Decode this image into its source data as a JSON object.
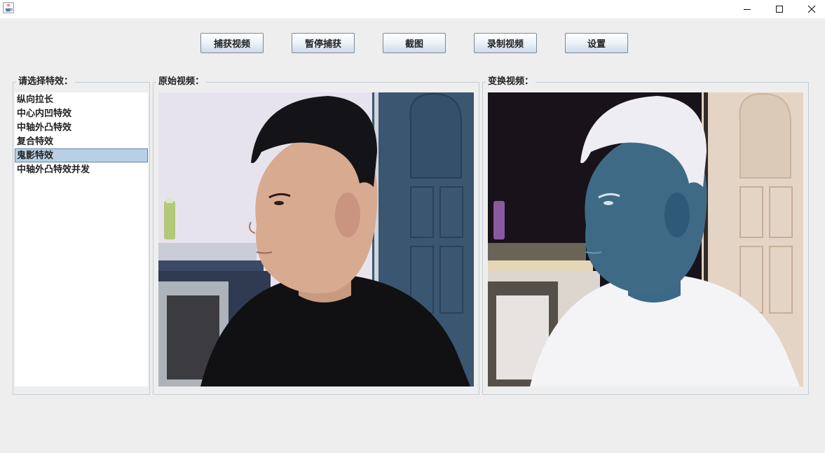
{
  "window": {
    "app_icon": "java-coffee-icon"
  },
  "toolbar": {
    "buttons": [
      {
        "label": "捕获视频"
      },
      {
        "label": "暂停捕获"
      },
      {
        "label": "截图"
      },
      {
        "label": "录制视频"
      },
      {
        "label": "设置"
      }
    ]
  },
  "effects_panel": {
    "title": "请选择特效：",
    "items": [
      {
        "label": "纵向拉长"
      },
      {
        "label": "中心内凹特效"
      },
      {
        "label": "中轴外凸特效"
      },
      {
        "label": "复合特效"
      },
      {
        "label": "鬼影特效"
      },
      {
        "label": "中轴外凸特效并发"
      }
    ],
    "selected_index": 4
  },
  "original_panel": {
    "title": "原始视频："
  },
  "transformed_panel": {
    "title": "变换视频："
  },
  "colors": {
    "selection": "#b8cfe5",
    "panel_border": "#c3cdd6",
    "window_bg": "#eeeeee"
  }
}
